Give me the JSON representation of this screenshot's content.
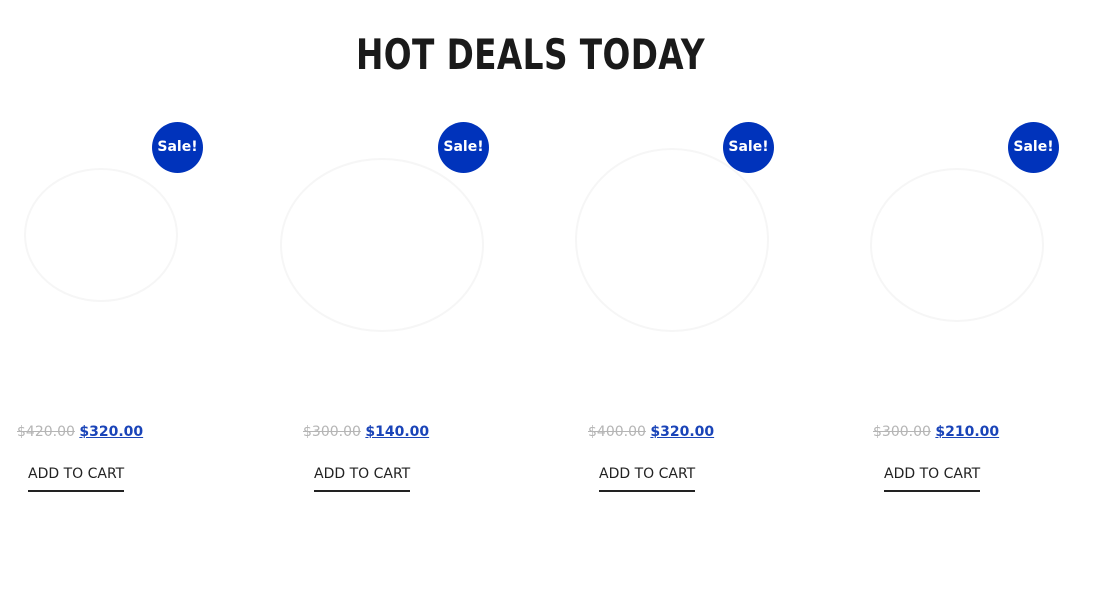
{
  "section": {
    "title": "HOT DEALS TODAY"
  },
  "colors": {
    "badge": "#0033bb",
    "price_new": "#1a44b8",
    "price_old": "#b5b5b5",
    "title": "#1a1a1a"
  },
  "products": [
    {
      "badge": "Sale!",
      "old_price": "$420.00",
      "new_price": "$320.00",
      "cta": "ADD TO CART"
    },
    {
      "badge": "Sale!",
      "old_price": "$300.00",
      "new_price": "$140.00",
      "cta": "ADD TO CART"
    },
    {
      "badge": "Sale!",
      "old_price": "$400.00",
      "new_price": "$320.00",
      "cta": "ADD TO CART"
    },
    {
      "badge": "Sale!",
      "old_price": "$300.00",
      "new_price": "$210.00",
      "cta": "ADD TO CART"
    }
  ]
}
